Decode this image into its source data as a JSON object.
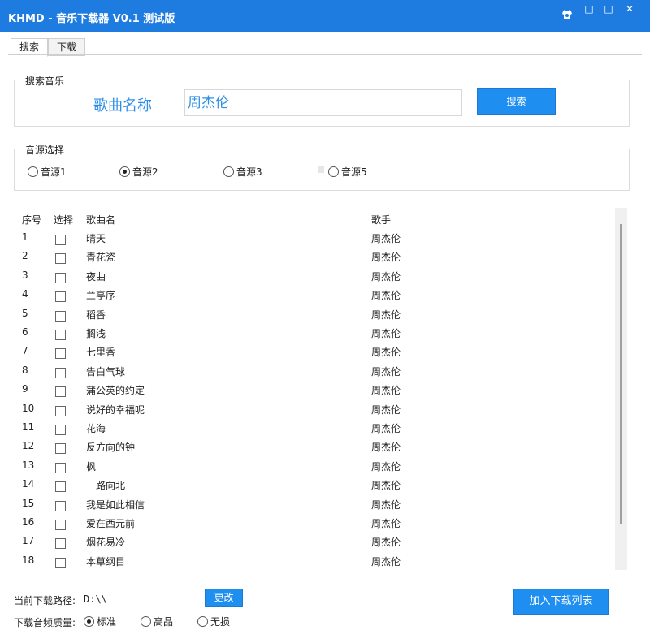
{
  "window": {
    "title": "KHMD - 音乐下载器 V0.1 测试版",
    "controls": [
      "□",
      "□",
      "✕"
    ]
  },
  "tabs": [
    {
      "label": "搜索",
      "active": true
    },
    {
      "label": "下载",
      "active": false
    }
  ],
  "search": {
    "group_title": "搜索音乐",
    "field_label": "歌曲名称",
    "value": "周杰伦",
    "button": "搜索"
  },
  "source": {
    "group_title": "音源选择",
    "options": [
      {
        "label": "音源1",
        "selected": false
      },
      {
        "label": "音源2",
        "selected": true
      },
      {
        "label": "音源3",
        "selected": false
      },
      {
        "label": "音源5",
        "selected": false
      }
    ]
  },
  "table": {
    "headers": {
      "no": "序号",
      "select": "选择",
      "song": "歌曲名",
      "singer": "歌手"
    },
    "rows": [
      {
        "no": "1",
        "song": "晴天",
        "singer": "周杰伦"
      },
      {
        "no": "2",
        "song": "青花瓷",
        "singer": "周杰伦"
      },
      {
        "no": "3",
        "song": "夜曲",
        "singer": "周杰伦"
      },
      {
        "no": "4",
        "song": "兰亭序",
        "singer": "周杰伦"
      },
      {
        "no": "5",
        "song": "稻香",
        "singer": "周杰伦"
      },
      {
        "no": "6",
        "song": "搁浅",
        "singer": "周杰伦"
      },
      {
        "no": "7",
        "song": "七里香",
        "singer": "周杰伦"
      },
      {
        "no": "8",
        "song": "告白气球",
        "singer": "周杰伦"
      },
      {
        "no": "9",
        "song": "蒲公英的约定",
        "singer": "周杰伦"
      },
      {
        "no": "10",
        "song": "说好的幸福呢",
        "singer": "周杰伦"
      },
      {
        "no": "11",
        "song": "花海",
        "singer": "周杰伦"
      },
      {
        "no": "12",
        "song": "反方向的钟",
        "singer": "周杰伦"
      },
      {
        "no": "13",
        "song": "枫",
        "singer": "周杰伦"
      },
      {
        "no": "14",
        "song": "一路向北",
        "singer": "周杰伦"
      },
      {
        "no": "15",
        "song": "我是如此相信",
        "singer": "周杰伦"
      },
      {
        "no": "16",
        "song": "爱在西元前",
        "singer": "周杰伦"
      },
      {
        "no": "17",
        "song": "烟花易冷",
        "singer": "周杰伦"
      },
      {
        "no": "18",
        "song": "本草纲目",
        "singer": "周杰伦"
      }
    ]
  },
  "footer": {
    "path_label": "当前下载路径:",
    "path_value": "D:\\\\",
    "change_button": "更改",
    "add_button": "加入下载列表",
    "quality_label": "下载音频质量:",
    "qualities": [
      {
        "label": "标准",
        "selected": true
      },
      {
        "label": "高品",
        "selected": false
      },
      {
        "label": "无损",
        "selected": false
      }
    ]
  },
  "colors": {
    "titlebar": "#1e7be0",
    "accent": "#1e8ef0",
    "label_blue": "#2f8fe6"
  }
}
